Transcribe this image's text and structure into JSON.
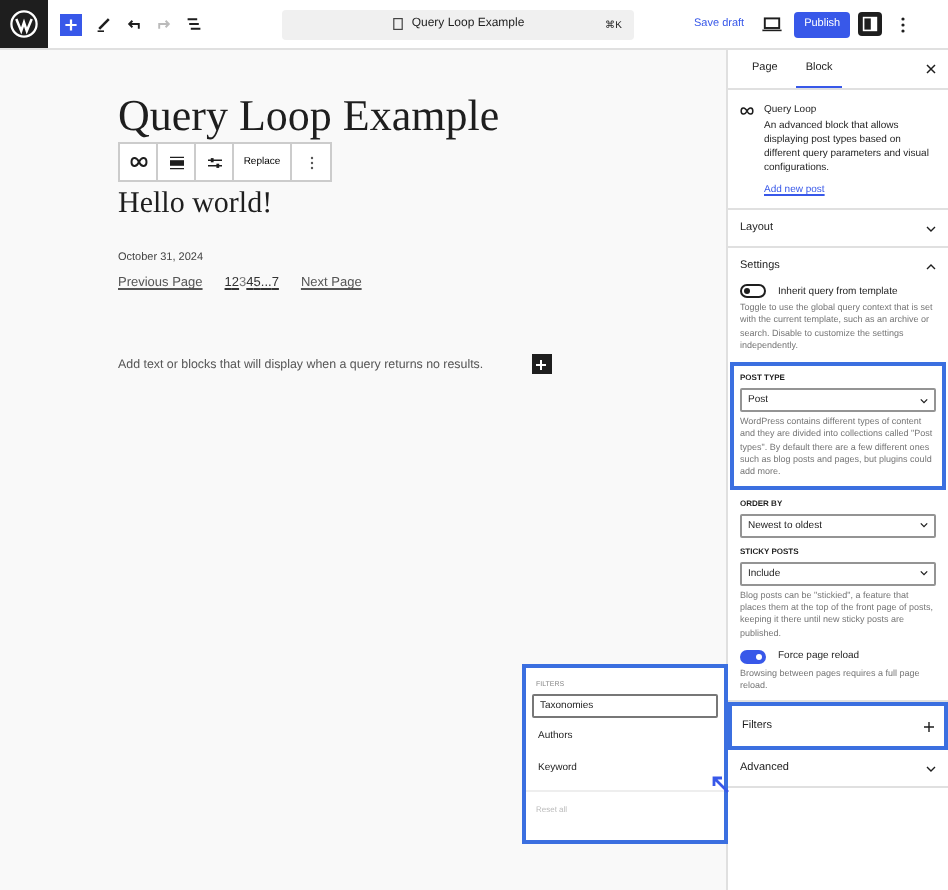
{
  "topbar": {
    "document_title": "Query Loop Example",
    "shortcut": "⌘K",
    "save_draft": "Save draft",
    "publish": "Publish"
  },
  "canvas": {
    "title": "Query Loop Example",
    "toolbar": {
      "replace": "Replace"
    },
    "post_title": "Hello world!",
    "date": "October 31, 2024",
    "pagination": {
      "previous": "Previous Page",
      "pages": [
        {
          "label": "1",
          "selected": false
        },
        {
          "label": "2",
          "selected": false
        },
        {
          "label": "3",
          "selected": true
        },
        {
          "label": "4",
          "selected": false
        },
        {
          "label": "5",
          "selected": false
        },
        {
          "label": "...",
          "selected": false
        },
        {
          "label": "7",
          "selected": false
        }
      ],
      "next": "Next Page"
    },
    "no_results": "Add text or blocks that will display when a query returns no results."
  },
  "sidebar": {
    "tabs": [
      {
        "label": "Page",
        "selected": false
      },
      {
        "label": "Block",
        "selected": true
      }
    ],
    "block": {
      "name": "Query Loop",
      "description": "An advanced block that allows displaying post types based on different query parameters and visual configurations.",
      "link": "Add new post"
    },
    "layout": {
      "label": "Layout",
      "expanded": false
    },
    "settings": {
      "label": "Settings",
      "expanded": true,
      "inherit": {
        "label": "Inherit query from template",
        "on": false,
        "help": "Toggle to use the global query context that is set with the current template, such as an archive or search. Disable to customize the settings independently."
      },
      "post_type": {
        "label": "POST TYPE",
        "value": "Post",
        "highlighted": true,
        "help": "WordPress contains different types of content and they are divided into collections called \"Post types\". By default there are a few different ones such as blog posts and pages, but plugins could add more."
      },
      "order_by": {
        "label": "ORDER BY",
        "value": "Newest to oldest"
      },
      "sticky": {
        "label": "STICKY POSTS",
        "value": "Include",
        "help": "Blog posts can be \"stickied\", a feature that places them at the top of the front page of posts, keeping it there until new sticky posts are published."
      },
      "reload": {
        "label": "Force page reload",
        "on": true,
        "help": "Browsing between pages requires a full page reload."
      }
    },
    "filters": {
      "label": "Filters",
      "highlighted": true
    },
    "advanced": {
      "label": "Advanced",
      "expanded": false
    }
  },
  "filters_popup": {
    "label": "FILTERS",
    "items": [
      {
        "label": "Taxonomies",
        "selected": true
      },
      {
        "label": "Authors",
        "selected": false
      },
      {
        "label": "Keyword",
        "selected": false
      }
    ],
    "reset": "Reset all"
  }
}
